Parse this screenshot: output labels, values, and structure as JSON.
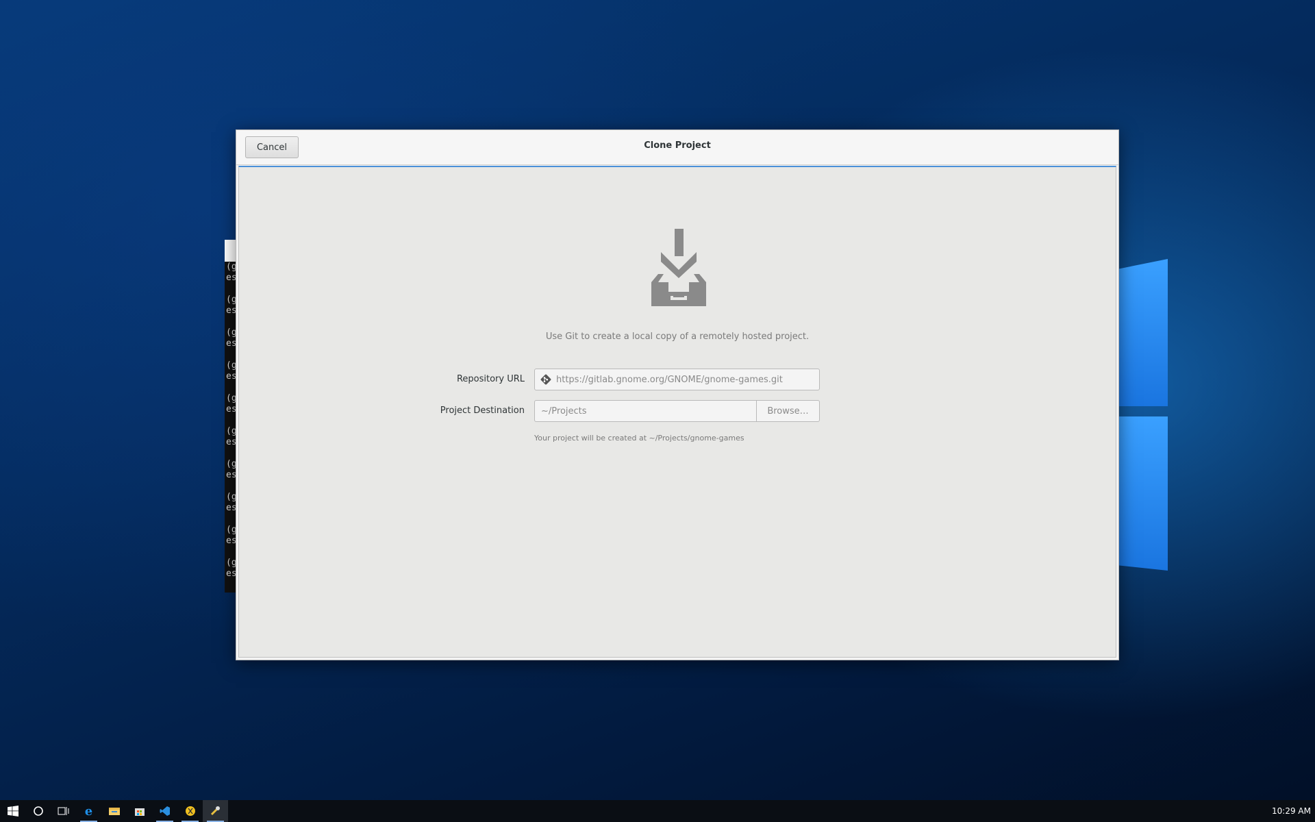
{
  "dialog": {
    "title": "Clone Project",
    "cancel_label": "Cancel",
    "description": "Use Git to create a local copy of a remotely hosted project.",
    "repository_url": {
      "label": "Repository URL",
      "placeholder": "https://gitlab.gnome.org/GNOME/gnome-games.git"
    },
    "project_destination": {
      "label": "Project Destination",
      "value": "~/Projects",
      "browse_label": "Browse…"
    },
    "hint": "Your project will be created at ~/Projects/gnome-games",
    "accent_color": "#4a90d9"
  },
  "terminal": {
    "lines": [
      "(g",
      "es"
    ]
  },
  "taskbar": {
    "items": [
      {
        "name": "start-icon"
      },
      {
        "name": "search-icon"
      },
      {
        "name": "task-view-icon"
      },
      {
        "name": "edge-icon"
      },
      {
        "name": "file-explorer-icon"
      },
      {
        "name": "store-icon"
      },
      {
        "name": "vscode-icon"
      },
      {
        "name": "app-yellow-icon"
      },
      {
        "name": "builder-icon"
      }
    ],
    "clock": "10:29 AM"
  }
}
